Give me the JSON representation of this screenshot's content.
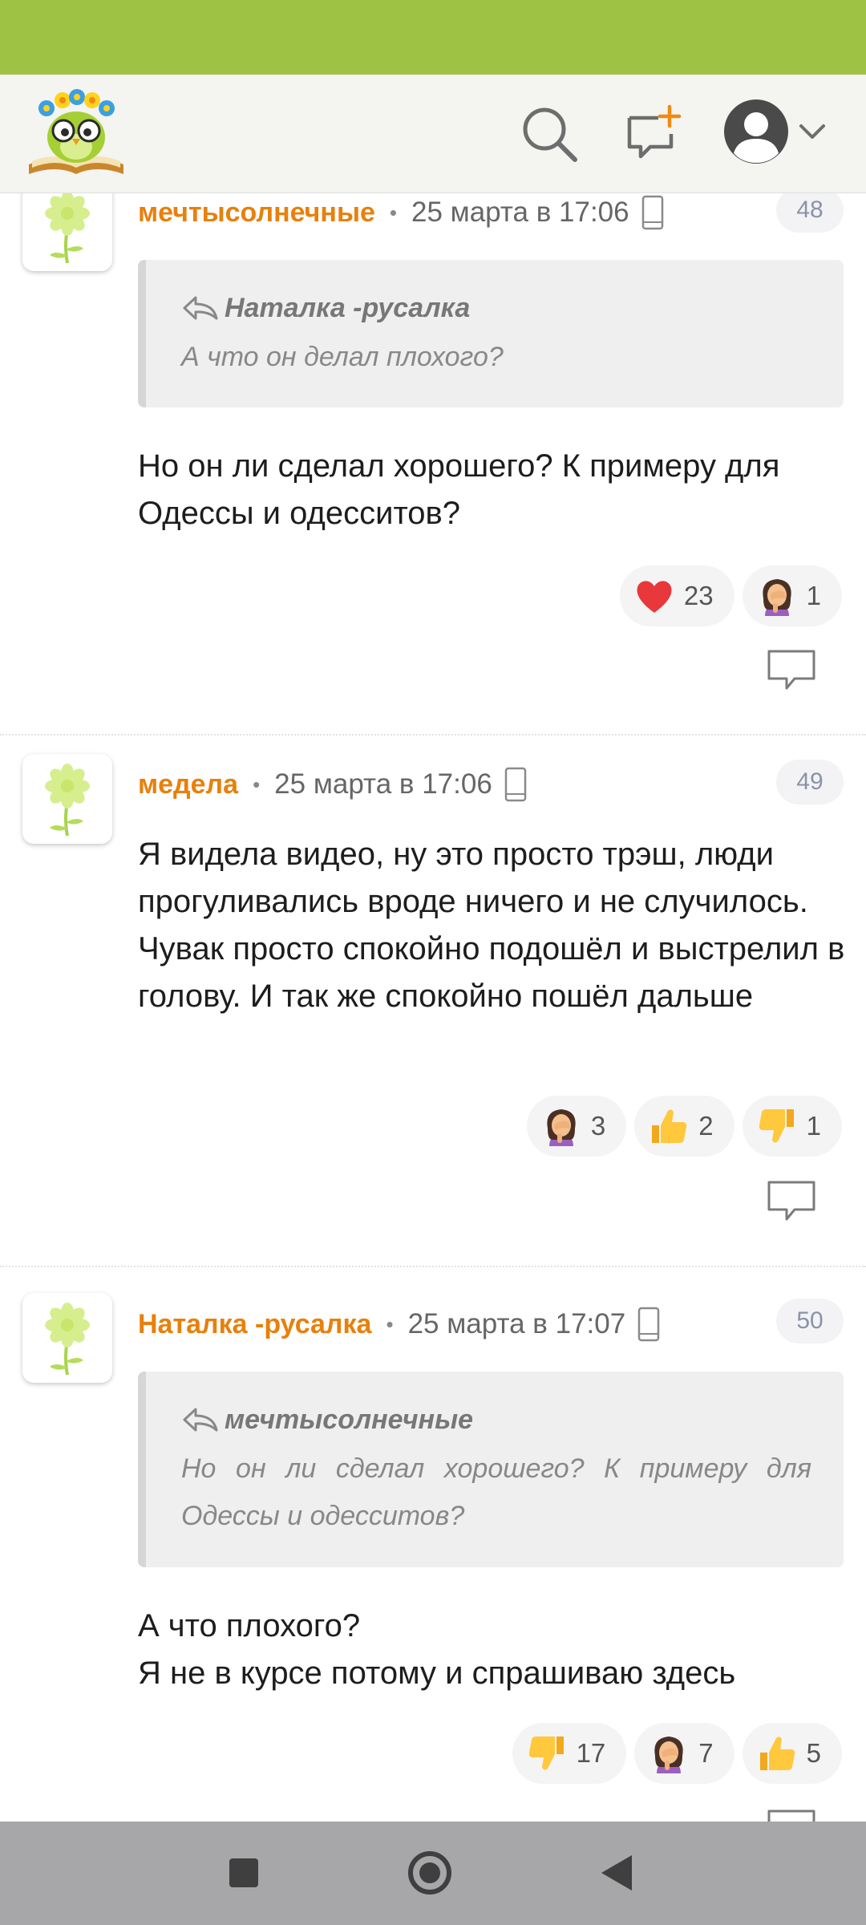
{
  "header": {
    "logo": "owl-with-flower-wreath-logo",
    "search_icon": "search-icon",
    "new_post_icon": "new-post-icon",
    "avatar_icon": "user-avatar-icon",
    "menu_icon": "chevron-down-icon"
  },
  "comments": [
    {
      "author": "мечтысолнечные",
      "date": "25 марта в 17:06",
      "number": "48",
      "quote": {
        "author": "Наталка -русалка",
        "text": "А что он делал плохого?"
      },
      "text": "Но он ли сделал хорошего? К примеру для Одессы и одесситов?",
      "reactions": [
        {
          "icon": "heart-icon",
          "count": "23"
        },
        {
          "icon": "facepalm-icon",
          "count": "1"
        }
      ]
    },
    {
      "author": "медела",
      "date": "25 марта в 17:06",
      "number": "49",
      "text": "Я видела видео, ну это просто трэш, люди прогуливались вроде ничего и не случилось. Чувак просто спокойно подошёл и выстрелил в голову. И так же спокойно пошёл дальше",
      "reactions": [
        {
          "icon": "facepalm-icon",
          "count": "3"
        },
        {
          "icon": "thumbs-up-icon",
          "count": "2"
        },
        {
          "icon": "thumbs-down-icon",
          "count": "1"
        }
      ]
    },
    {
      "author": "Наталка -русалка",
      "date": "25 марта в 17:07",
      "number": "50",
      "quote": {
        "author": "мечтысолнечные",
        "text": "Но он ли сделал хорошего? К примеру для Одессы и одесситов?"
      },
      "text_line1": "А что плохого?",
      "text_line2": "Я не в курсе потому и спрашиваю здесь",
      "reactions": [
        {
          "icon": "thumbs-down-icon",
          "count": "17"
        },
        {
          "icon": "facepalm-icon",
          "count": "7"
        },
        {
          "icon": "thumbs-up-icon",
          "count": "5"
        }
      ]
    }
  ],
  "navbar": {
    "recents_icon": "square-recents-icon",
    "home_icon": "circle-home-icon",
    "back_icon": "triangle-back-icon"
  },
  "colors": {
    "status_bar": "#9dc244",
    "author": "#e8800c",
    "navbar": "#a7a7a9"
  }
}
